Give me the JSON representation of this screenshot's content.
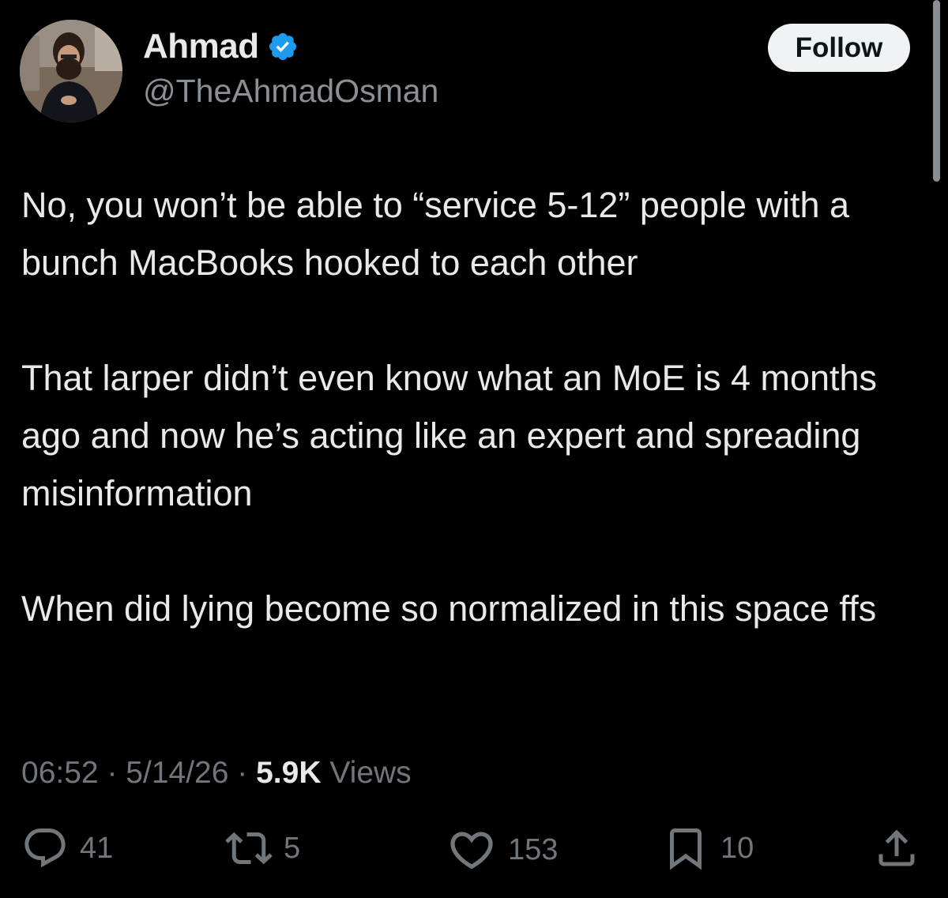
{
  "author": {
    "name": "Ahmad",
    "handle": "@TheAhmadOsman",
    "verified": true
  },
  "follow_label": "Follow",
  "tweet": {
    "paragraphs": [
      "No, you won’t be able to “service 5-12” people with a bunch MacBooks hooked to each other",
      "That larper didn’t even know what an MoE is 4 months ago and now he’s acting like an expert and spreading misinformation",
      "When did lying become so normalized in this space ffs"
    ]
  },
  "meta": {
    "time": "06:52",
    "separator": "·",
    "date": "5/14/26",
    "views_count": "5.9K",
    "views_label": "Views"
  },
  "actions": {
    "replies": "41",
    "reposts": "5",
    "likes": "153",
    "bookmarks": "10"
  },
  "colors": {
    "background": "#000000",
    "text": "#e7e9ea",
    "muted": "#71767b",
    "verified": "#1d9bf0",
    "follow_bg": "#eff3f4"
  },
  "icons": [
    "verified-badge-icon",
    "reply-icon",
    "repost-icon",
    "like-icon",
    "bookmark-icon",
    "share-icon"
  ]
}
